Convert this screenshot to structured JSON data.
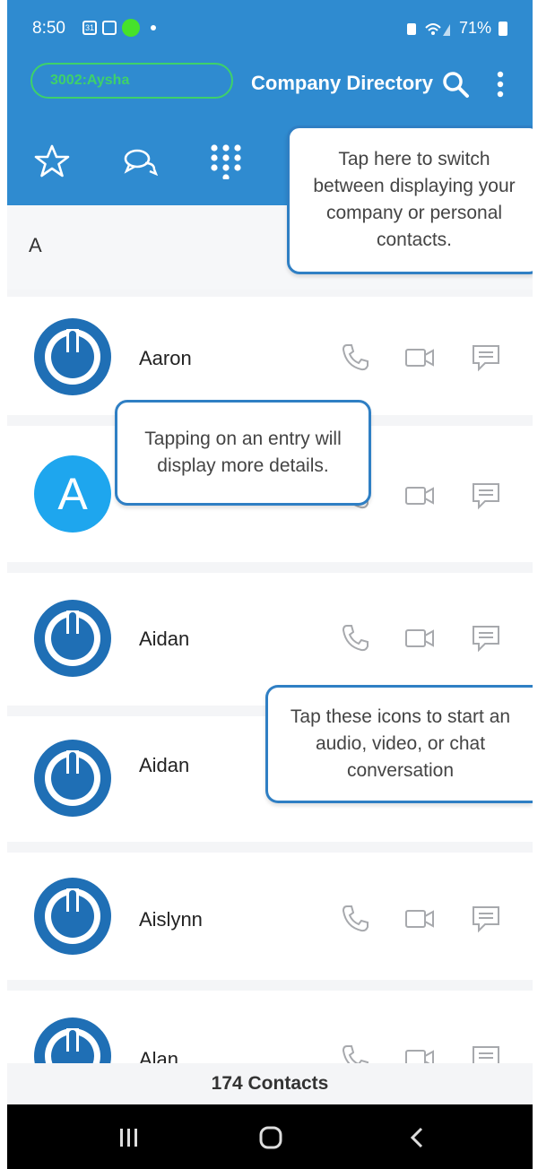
{
  "status_bar": {
    "time": "8:50",
    "calendar_badge": "31",
    "battery_text": "71%"
  },
  "app_bar": {
    "account": "3002:Aysha",
    "title": "Company Directory",
    "tabs": [
      "favorites-icon",
      "chat-icon",
      "dialpad-icon",
      "contacts-icon"
    ]
  },
  "section": {
    "letter": "A"
  },
  "contacts": [
    {
      "name": "Aaron",
      "avatar": "power-logo"
    },
    {
      "name": "",
      "avatar": "letter",
      "letter": "A"
    },
    {
      "name": "Aidan",
      "avatar": "power-logo"
    },
    {
      "name": "Aidan",
      "avatar": "power-logo"
    },
    {
      "name": "Aislynn",
      "avatar": "power-logo"
    },
    {
      "name": "Alan",
      "avatar": "power-logo"
    }
  ],
  "footer": {
    "count": "174 Contacts"
  },
  "tooltips": {
    "switch": "Tap here to switch between displaying your company or personal contacts.",
    "entry": "Tapping on an entry will display more details.",
    "icons": "Tap these icons to start an audio, video, or chat conversation"
  },
  "colors": {
    "brand": "#2f8bd0",
    "tooltip_border": "#2f7fc4",
    "logo": "#1f6fb5",
    "status_green": "#46e22a"
  }
}
